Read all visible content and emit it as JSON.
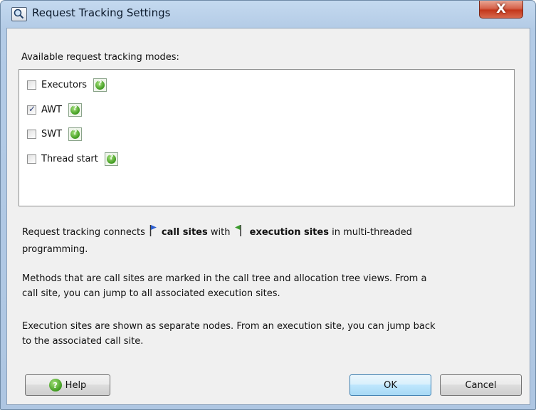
{
  "window": {
    "title": "Request Tracking Settings",
    "close_glyph": "X"
  },
  "modes": {
    "header": "Available request tracking modes:",
    "items": [
      {
        "label": "Executors",
        "checked": false
      },
      {
        "label": "AWT",
        "checked": true
      },
      {
        "label": "SWT",
        "checked": false
      },
      {
        "label": "Thread start",
        "checked": false
      }
    ]
  },
  "description": {
    "p1_prefix": "Request tracking connects",
    "p1_call_sites": "call sites",
    "p1_with": "with",
    "p1_execution_sites": "execution sites",
    "p1_suffix": "in multi-threaded",
    "p1_line2": "programming.",
    "p2_line1": "Methods that are call sites are marked in the call tree and allocation tree views. From a",
    "p2_line2": "call site, you can jump to all associated execution sites.",
    "p3_line1": "Execution sites are shown as separate nodes. From an execution site, you can jump back",
    "p3_line2": "to the associated call site."
  },
  "buttons": {
    "help": "Help",
    "ok": "OK",
    "cancel": "Cancel"
  },
  "colors": {
    "call_site_flag": "#2d5fd0",
    "execution_site_flag": "#3c9a2e",
    "help_green": "#3f9a1f"
  }
}
